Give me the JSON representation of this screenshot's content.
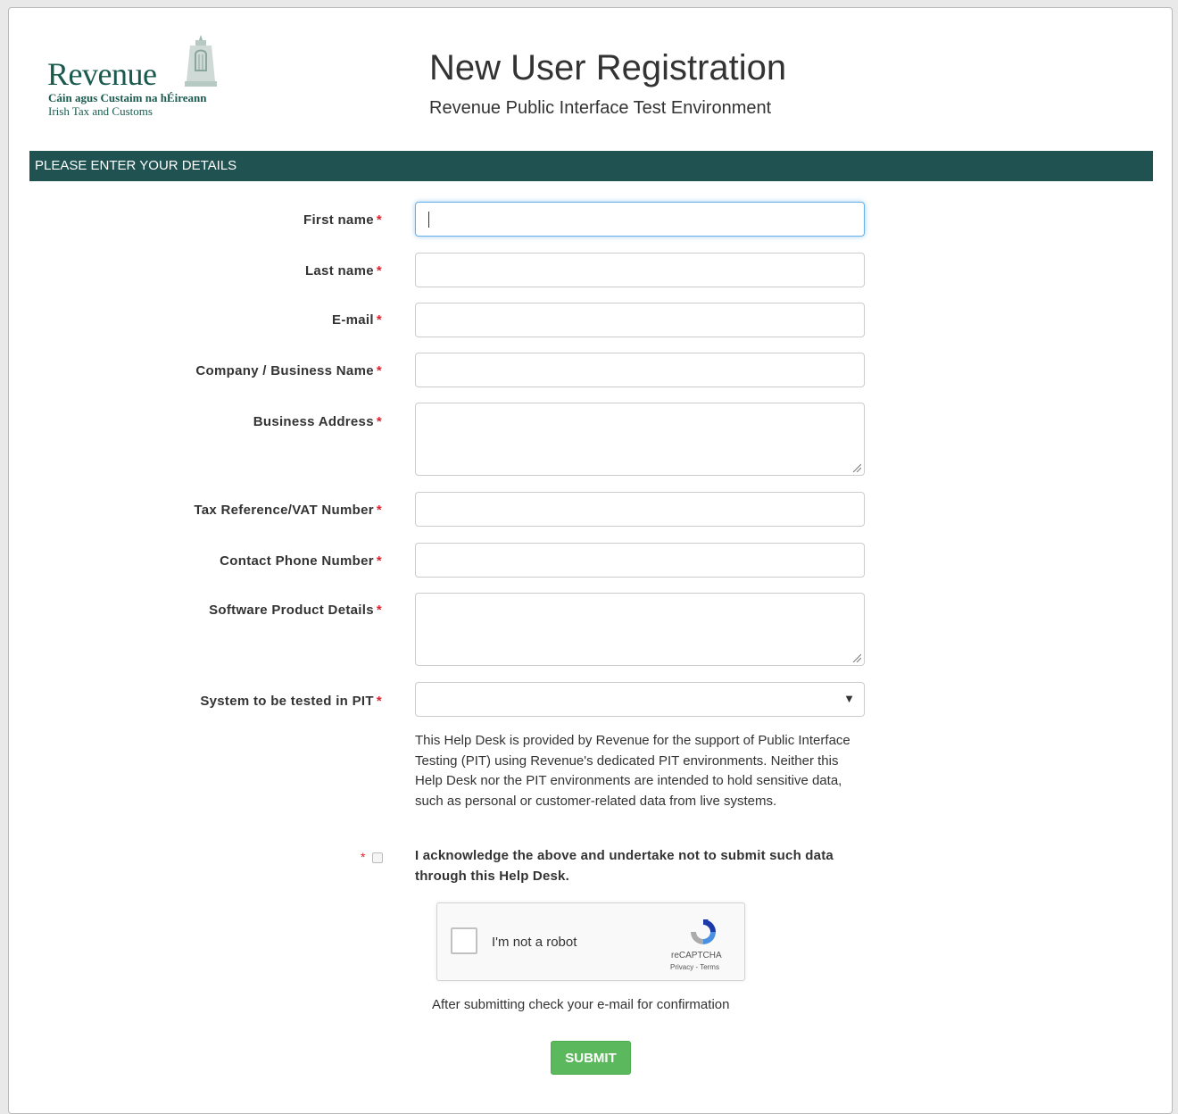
{
  "logo": {
    "word": "Revenue",
    "line1": "Cáin agus Custaim na hÉireann",
    "line2": "Irish Tax and Customs",
    "icon": "harp-icon",
    "color": "#1a5a4e"
  },
  "header": {
    "title": "New User Registration",
    "subtitle": "Revenue Public Interface Test Environment"
  },
  "section": {
    "heading": "PLEASE ENTER YOUR DETAILS",
    "color": "#1f5250"
  },
  "form": {
    "required_marker": "*",
    "fields": {
      "first_name": {
        "label": "First name",
        "value": ""
      },
      "last_name": {
        "label": "Last name",
        "value": ""
      },
      "email": {
        "label": "E-mail",
        "value": ""
      },
      "company": {
        "label": "Company / Business Name",
        "value": ""
      },
      "address": {
        "label": "Business Address",
        "value": ""
      },
      "tax_ref": {
        "label": "Tax Reference/VAT Number",
        "value": ""
      },
      "phone": {
        "label": "Contact Phone Number",
        "value": ""
      },
      "software": {
        "label": "Software Product Details",
        "value": ""
      },
      "system": {
        "label": "System to be tested in PIT",
        "selected": ""
      }
    },
    "help_text": "This Help Desk is provided by Revenue for the support of Public Interface Testing (PIT) using Revenue's dedicated PIT environments. Neither this Help Desk nor the PIT environments are intended to hold sensitive data, such as personal or customer-related data from live systems.",
    "acknowledge": {
      "label": "I acknowledge the above and undertake not to submit such data through this Help Desk.",
      "checked": false
    },
    "captcha": {
      "label": "I'm not a robot",
      "brand": "reCAPTCHA",
      "links": "Privacy - Terms"
    },
    "confirmation_note": "After submitting check your e-mail for confirmation",
    "submit_label": "SUBMIT",
    "submit_color": "#5cb85c"
  }
}
